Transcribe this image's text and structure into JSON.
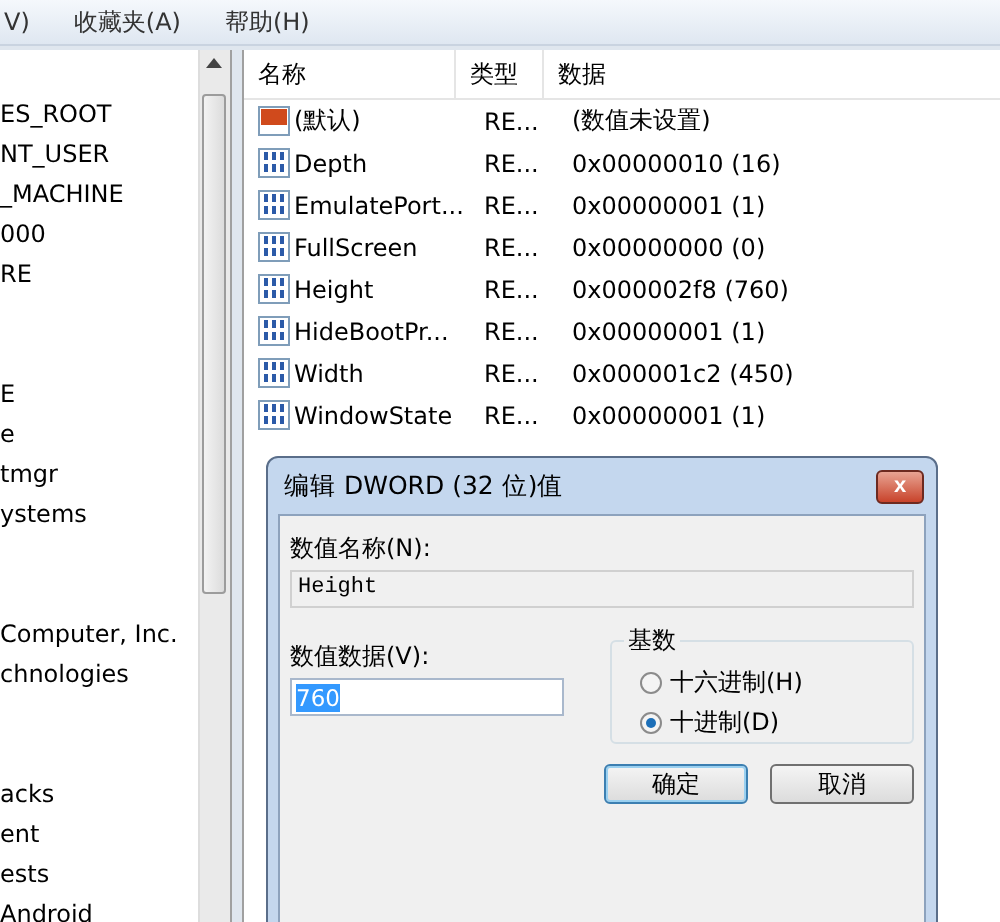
{
  "menu_bar": {
    "items": [
      "V)",
      "收藏夹(A)",
      "帮助(H)"
    ]
  },
  "tree": {
    "groups": [
      [
        "ES_ROOT",
        "NT_USER",
        "_MACHINE",
        "000",
        "RE"
      ],
      [
        "E",
        "e",
        "tmgr",
        "ystems"
      ],
      [
        "Computer, Inc.",
        "chnologies"
      ],
      [
        "acks",
        "ent",
        "ests",
        "Android"
      ]
    ]
  },
  "values_table": {
    "columns": [
      "名称",
      "类型",
      "数据"
    ],
    "rows": [
      {
        "kind": "string",
        "name": "(默认)",
        "type": "RE...",
        "data": "(数值未设置)"
      },
      {
        "kind": "binary",
        "name": "Depth",
        "type": "RE...",
        "data": "0x00000010 (16)"
      },
      {
        "kind": "binary",
        "name": "EmulatePort...",
        "type": "RE...",
        "data": "0x00000001 (1)"
      },
      {
        "kind": "binary",
        "name": "FullScreen",
        "type": "RE...",
        "data": "0x00000000 (0)"
      },
      {
        "kind": "binary",
        "name": "Height",
        "type": "RE...",
        "data": "0x000002f8 (760)"
      },
      {
        "kind": "binary",
        "name": "HideBootPr...",
        "type": "RE...",
        "data": "0x00000001 (1)"
      },
      {
        "kind": "binary",
        "name": "Width",
        "type": "RE...",
        "data": "0x000001c2 (450)"
      },
      {
        "kind": "binary",
        "name": "WindowState",
        "type": "RE...",
        "data": "0x00000001 (1)"
      }
    ]
  },
  "dialog": {
    "title": "编辑 DWORD (32 位)值",
    "close": "x",
    "name_label": "数值名称(N):",
    "name_value": "Height",
    "data_label": "数值数据(V):",
    "data_value": "760",
    "base_label": "基数",
    "base_options": [
      {
        "label": "十六进制(H)",
        "selected": false
      },
      {
        "label": "十进制(D)",
        "selected": true
      }
    ],
    "buttons": [
      {
        "label": "确定",
        "default": true
      },
      {
        "label": "取消",
        "default": false
      }
    ]
  }
}
